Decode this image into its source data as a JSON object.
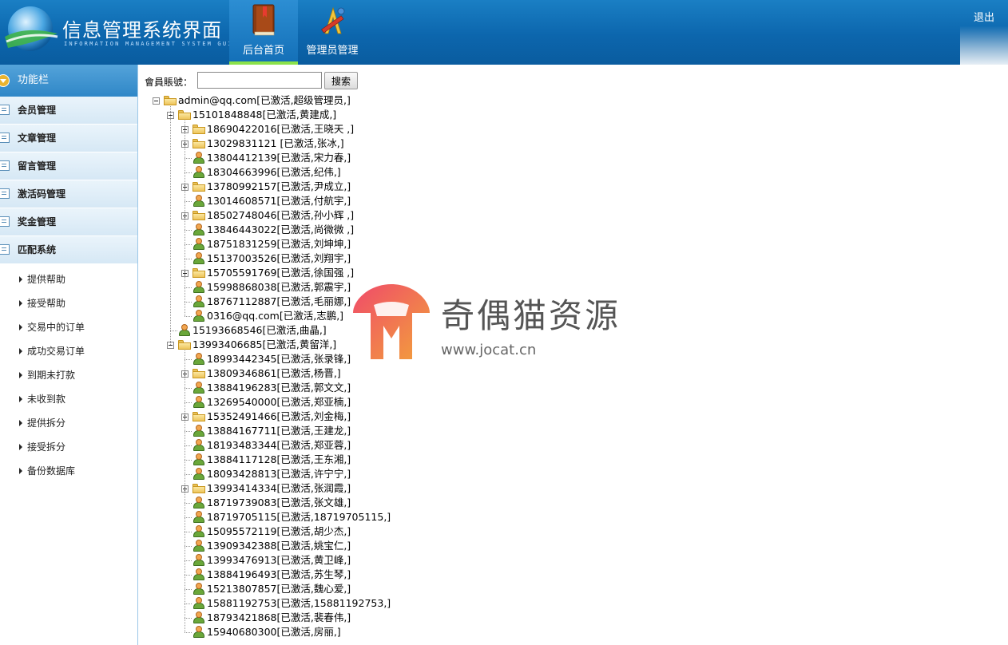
{
  "header": {
    "title": "信息管理系统界面",
    "subtitle": "INFORMATION MANAGEMENT SYSTEM GUI",
    "nav": [
      {
        "label": "后台首页",
        "icon": "book-icon",
        "active": true
      },
      {
        "label": "管理员管理",
        "icon": "tools-icon",
        "active": false
      }
    ],
    "logout": "退出"
  },
  "sidebar": {
    "heading": "功能栏",
    "menu": [
      {
        "label": "会员管理",
        "icon": "list-icon"
      },
      {
        "label": "文章管理",
        "icon": "edit-icon"
      },
      {
        "label": "留言管理",
        "icon": "note-icon"
      },
      {
        "label": "激活码管理",
        "icon": "calendar-icon"
      },
      {
        "label": "奖金管理",
        "icon": "calendar-icon"
      },
      {
        "label": "匹配系统",
        "icon": "calendar-icon"
      }
    ],
    "submenu": [
      "提供帮助",
      "接受帮助",
      "交易中的订单",
      "成功交易订单",
      "到期未打款",
      "未收到款",
      "提供拆分",
      "接受拆分",
      "备份数据库"
    ]
  },
  "search": {
    "label": "會員賬號：",
    "value": "",
    "button": "搜索"
  },
  "tree": {
    "root": {
      "text": "admin@qq.com[已激活,超级管理员,]",
      "type": "folder",
      "state": "expanded"
    },
    "groups": [
      {
        "text": "15101848848[已激活,黄建成,]",
        "type": "folder",
        "state": "expanded",
        "children": [
          {
            "text": "18690422016[已激活,王晓天 ,]",
            "type": "folder",
            "state": "collapsed"
          },
          {
            "text": "13029831121 [已激活,张冰,]",
            "type": "folder",
            "state": "collapsed"
          },
          {
            "text": "13804412139[已激活,宋力春,]",
            "type": "user"
          },
          {
            "text": "18304663996[已激活,纪伟,]",
            "type": "user"
          },
          {
            "text": "13780992157[已激活,尹成立,]",
            "type": "folder",
            "state": "collapsed"
          },
          {
            "text": "13014608571[已激活,付航宇,]",
            "type": "user"
          },
          {
            "text": "18502748046[已激活,孙小辉 ,]",
            "type": "folder",
            "state": "collapsed"
          },
          {
            "text": "13846443022[已激活,尚微微 ,]",
            "type": "user"
          },
          {
            "text": "18751831259[已激活,刘坤坤,]",
            "type": "user"
          },
          {
            "text": "15137003526[已激活,刘翔宇,]",
            "type": "user"
          },
          {
            "text": "15705591769[已激活,徐国强 ,]",
            "type": "folder",
            "state": "collapsed"
          },
          {
            "text": "15998868038[已激活,郭震宇,]",
            "type": "user"
          },
          {
            "text": "18767112887[已激活,毛丽娜,]",
            "type": "user"
          },
          {
            "text": "0316@qq.com[已激活,志鹏,]",
            "type": "user"
          }
        ]
      },
      {
        "text": "15193668546[已激活,曲晶,]",
        "type": "user",
        "children": []
      },
      {
        "text": "13993406685[已激活,黄留洋,]",
        "type": "folder",
        "state": "expanded",
        "children": [
          {
            "text": "18993442345[已激活,张录锋,]",
            "type": "user"
          },
          {
            "text": "13809346861[已激活,杨晋,]",
            "type": "folder",
            "state": "collapsed"
          },
          {
            "text": "13884196283[已激活,郭文文,]",
            "type": "user"
          },
          {
            "text": "13269540000[已激活,郑亚楠,]",
            "type": "user"
          },
          {
            "text": "15352491466[已激活,刘金梅,]",
            "type": "folder",
            "state": "collapsed"
          },
          {
            "text": "13884167711[已激活,王建龙,]",
            "type": "user"
          },
          {
            "text": "18193483344[已激活,郑亚蓉,]",
            "type": "user"
          },
          {
            "text": "13884117128[已激活,王东湘,]",
            "type": "user"
          },
          {
            "text": "18093428813[已激活,许宁宁,]",
            "type": "user"
          },
          {
            "text": "13993414334[已激活,张润霞,]",
            "type": "folder",
            "state": "collapsed"
          },
          {
            "text": "18719739083[已激活,张文雄,]",
            "type": "user"
          },
          {
            "text": "18719705115[已激活,18719705115,]",
            "type": "user"
          },
          {
            "text": "15095572119[已激活,胡少杰,]",
            "type": "user"
          },
          {
            "text": "13909342388[已激活,姚宝仁,]",
            "type": "user"
          },
          {
            "text": "13993476913[已激活,黄卫峰,]",
            "type": "user"
          },
          {
            "text": "13884196493[已激活,苏生琴,]",
            "type": "user"
          },
          {
            "text": "15213807857[已激活,魏心爱,]",
            "type": "user"
          },
          {
            "text": "15881192753[已激活,15881192753,]",
            "type": "user"
          },
          {
            "text": "18793421868[已激活,裴春伟,]",
            "type": "user"
          },
          {
            "text": "15940680300[已激活,房丽,]",
            "type": "user"
          }
        ]
      }
    ]
  },
  "watermark": {
    "text": "奇偶猫资源",
    "url": "www.jocat.cn"
  }
}
